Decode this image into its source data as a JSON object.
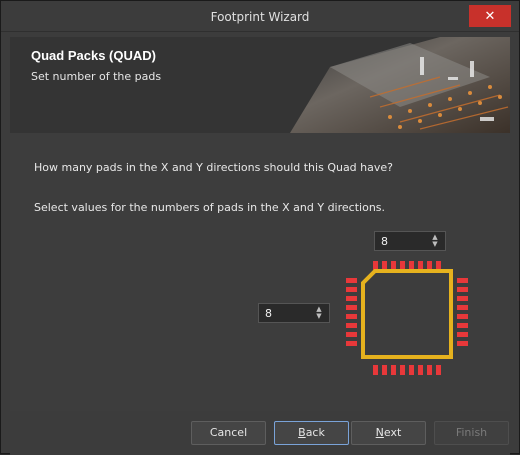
{
  "window": {
    "title": "Footprint Wizard",
    "close_glyph": "✕"
  },
  "header": {
    "title": "Quad Packs (QUAD)",
    "subtitle": "Set number of the pads"
  },
  "content": {
    "question": "How many pads in the X and Y directions should this Quad have?",
    "instruction": "Select values for the numbers of pads in the X and Y directions.",
    "pads_x": "8",
    "pads_y": "8"
  },
  "buttons": {
    "cancel": "Cancel",
    "back_mnemonic": "B",
    "back_rest": "ack",
    "next_mnemonic": "N",
    "next_rest": "ext",
    "finish": "Finish"
  },
  "colors": {
    "pad": "#e8383a",
    "outline": "#e6b21e",
    "close": "#c8312b"
  },
  "icons": {
    "spinner": "chevron-up-down-icon"
  }
}
